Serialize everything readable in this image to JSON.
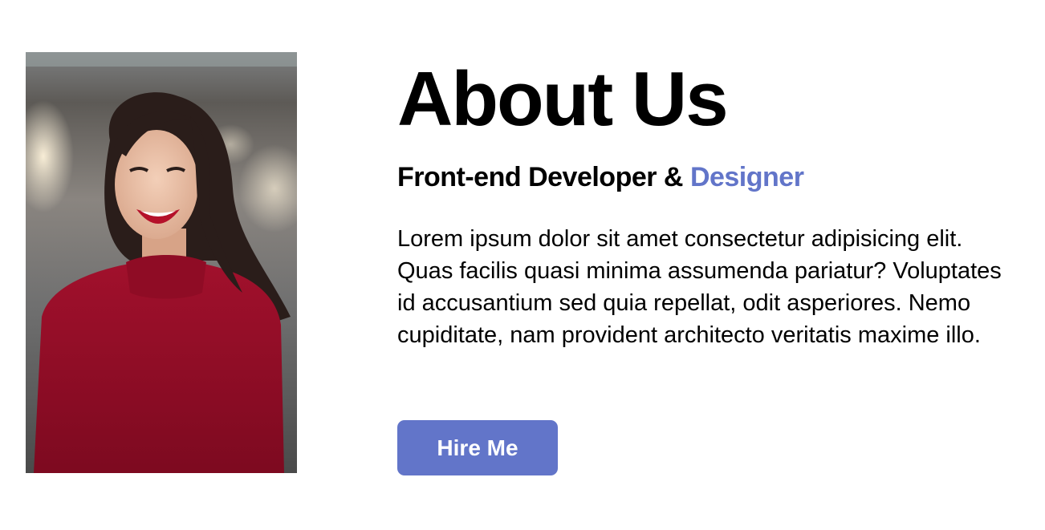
{
  "about": {
    "heading": "About Us",
    "subheading_prefix": "Front-end Developer & ",
    "subheading_accent": "Designer",
    "description": "Lorem ipsum dolor sit amet consectetur adipisicing elit. Quas facilis quasi minima assumenda pariatur? Voluptates id accusantium sed quia repellat, odit asperiores. Nemo cupiditate, nam provident architecto veritatis maxime illo.",
    "hire_button_label": "Hire Me"
  },
  "colors": {
    "accent": "#6275c9",
    "background": "#ffffff",
    "text": "#000000"
  }
}
